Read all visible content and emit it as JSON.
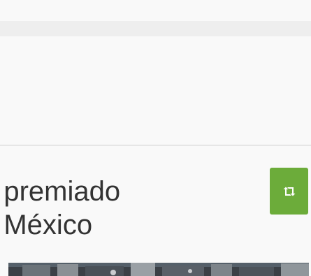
{
  "article": {
    "headline_line1": "o premiado",
    "headline_line2": "e México"
  },
  "share_button": {
    "icon": "retweet-icon",
    "color": "#6cac3a"
  },
  "colors": {
    "background": "#f9f9f9",
    "bar": "#eeeeee",
    "text": "#333333"
  }
}
